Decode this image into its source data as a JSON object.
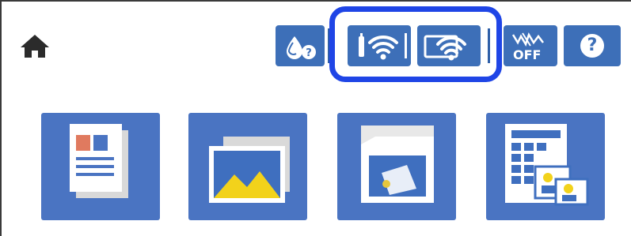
{
  "toolbar": {
    "home": {
      "icon": "home-icon"
    },
    "buttons": [
      {
        "id": "ink-status",
        "icon": "ink-drop-help-icon"
      },
      {
        "id": "wifi-status",
        "icon": "wifi-signal-icon"
      },
      {
        "id": "wifi-direct-status",
        "icon": "wifi-direct-icon"
      },
      {
        "id": "quiet-mode",
        "icon": "quiet-mode-off-icon",
        "label": "OFF"
      },
      {
        "id": "help",
        "icon": "help-icon",
        "label": "?"
      }
    ],
    "highlight": {
      "icon": "network-highlight-callout"
    }
  },
  "menu": {
    "tiles": [
      {
        "id": "copy",
        "icon": "copy-icon"
      },
      {
        "id": "print-photos",
        "icon": "photo-icon"
      },
      {
        "id": "scan",
        "icon": "scan-icon"
      },
      {
        "id": "various-prints",
        "icon": "photo-layout-icon"
      }
    ]
  },
  "colors": {
    "button_blue": "#3d6fb8",
    "tile_blue": "#4a74c2",
    "highlight": "#1f45e6",
    "home": "#2b2b2b"
  }
}
